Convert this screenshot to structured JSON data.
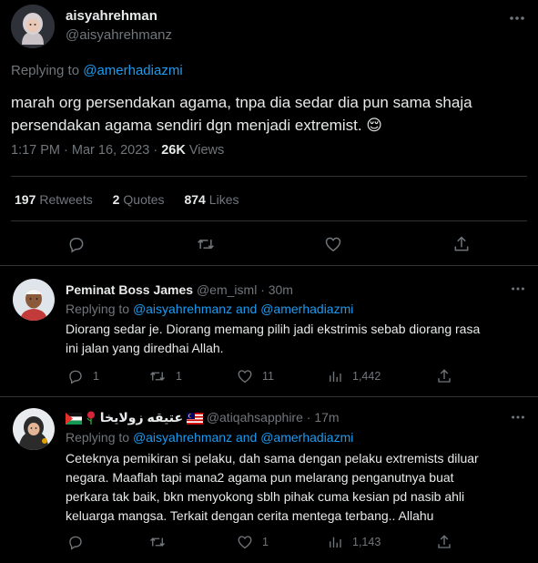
{
  "tweet": {
    "name": "aisyahrehman",
    "handle": "@aisyahrehmanz",
    "replying_prefix": "Replying to",
    "replying_to": "@amerhadiazmi",
    "text_line1": "marah org persendakan agama, tnpa dia sedar dia pun sama shaja",
    "text_line2": "persendakan agama sendiri dgn menjadi extremist.",
    "emoji": "😌",
    "time": "1:17 PM · Mar 16, 2023 ·",
    "views_count": "26K",
    "views_label": "Views",
    "retweets_count": "197",
    "retweets_label": "Retweets",
    "quotes_count": "2",
    "quotes_label": "Quotes",
    "likes_count": "874",
    "likes_label": "Likes"
  },
  "replies": [
    {
      "name": "Peminat Boss James",
      "handle": "@em_isml · 30m",
      "replying_prefix": "Replying to",
      "replying_to": "@aisyahrehmanz and @amerhadiazmi",
      "line1": "Diorang sedar je. Diorang memang pilih jadi ekstrimis sebab diorang rasa",
      "line2": "ini jalan yang diredhai Allah.",
      "replies": "1",
      "retweets": "1",
      "likes": "11",
      "views": "1,442"
    },
    {
      "name": "عتيقه زولايخا",
      "handle": "@atiqahsapphire · 17m",
      "replying_prefix": "Replying to",
      "replying_to": "@aisyahrehmanz and @amerhadiazmi",
      "line1": "Ceteknya pemikiran si pelaku, dah sama dengan pelaku extremists diluar",
      "line2": "negara. Maaflah tapi mana2 agama pun melarang penganutnya buat",
      "line3": "perkara tak baik, bkn menyokong sblh pihak cuma kesian pd nasib ahli",
      "line4": "keluarga mangsa. Terkait dengan cerita mentega terbang.. Allahu",
      "replies": "",
      "retweets": "",
      "likes": "1",
      "views": "1,143"
    }
  ]
}
